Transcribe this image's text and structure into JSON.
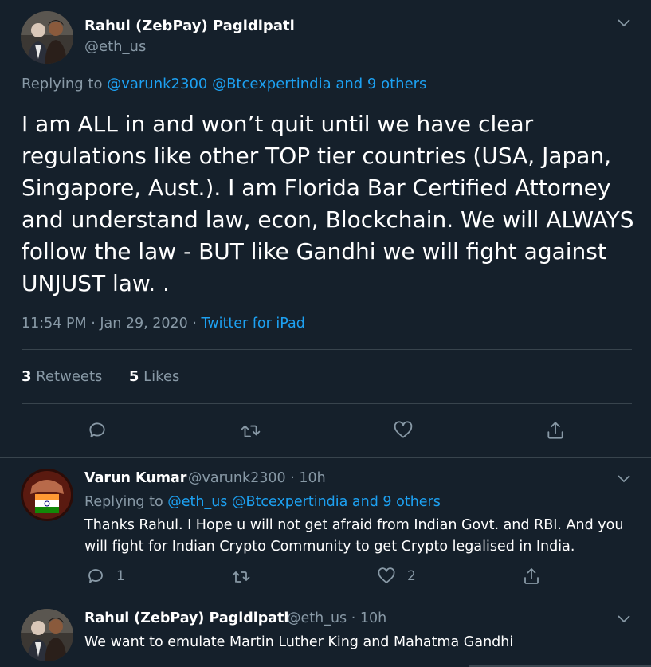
{
  "main_tweet": {
    "author_name": "Rahul (ZebPay) Pagidipati",
    "author_handle": "@eth_us",
    "replying_prefix": "Replying to",
    "replying_to": "@varunk2300 @Btcexpertindia and 9 others",
    "text": "I am ALL in and won’t quit until we have clear regulations like other TOP tier countries (USA, Japan, Singapore, Aust.).  I am Florida Bar Certified Attorney and understand law, econ, Blockchain.  We will ALWAYS follow the law - BUT like Gandhi we will fight against UNJUST law. .",
    "time": "11:54 PM · Jan 29, 2020 · ",
    "source": "Twitter for iPad",
    "retweets_count": "3",
    "retweets_label": "Retweets",
    "likes_count": "5",
    "likes_label": "Likes"
  },
  "reply_1": {
    "author_name": "Varun Kumar",
    "author_handle": "@varunk2300 · 10h",
    "replying_prefix": "Replying to",
    "replying_to": "@eth_us @Btcexpertindia and 9 others",
    "text": "Thanks Rahul. I Hope u will not get afraid from Indian Govt. and RBI. And you will fight for Indian Crypto Community to get Crypto legalised in India.",
    "reply_count": "1",
    "like_count": "2"
  },
  "reply_2": {
    "author_name": "Rahul (ZebPay) Pagidipati",
    "author_handle": "@eth_us · 10h",
    "text": "We want to emulate Martin Luther King and Mahatma Gandhi"
  },
  "colors": {
    "background": "#15202b",
    "accent": "#1da1f2",
    "secondary_text": "#8899a6",
    "divider": "#38444d"
  }
}
